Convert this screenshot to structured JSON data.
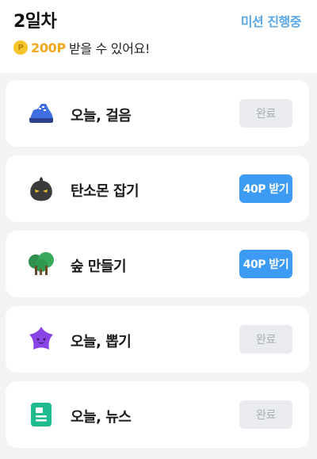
{
  "header": {
    "title": "2일차",
    "status_link": "미션 진행중",
    "coin_glyph": "P",
    "reward_points": "200P",
    "reward_text": "받을 수 있어요!"
  },
  "missions": [
    {
      "label": "오늘, 걸음",
      "button": "완료",
      "state": "done",
      "icon": "sneaker-icon"
    },
    {
      "label": "탄소몬 잡기",
      "button": "40P 받기",
      "state": "claim",
      "icon": "carbon-monster-icon"
    },
    {
      "label": "숲 만들기",
      "button": "40P 받기",
      "state": "claim",
      "icon": "tree-icon"
    },
    {
      "label": "오늘, 뽑기",
      "button": "완료",
      "state": "done",
      "icon": "purple-star-icon"
    },
    {
      "label": "오늘, 뉴스",
      "button": "완료",
      "state": "done",
      "icon": "news-icon"
    }
  ],
  "colors": {
    "accent_blue": "#3d9bf4",
    "link_blue": "#5aa8e6",
    "points_orange": "#f2a81d",
    "done_gray": "#e9ebee"
  }
}
